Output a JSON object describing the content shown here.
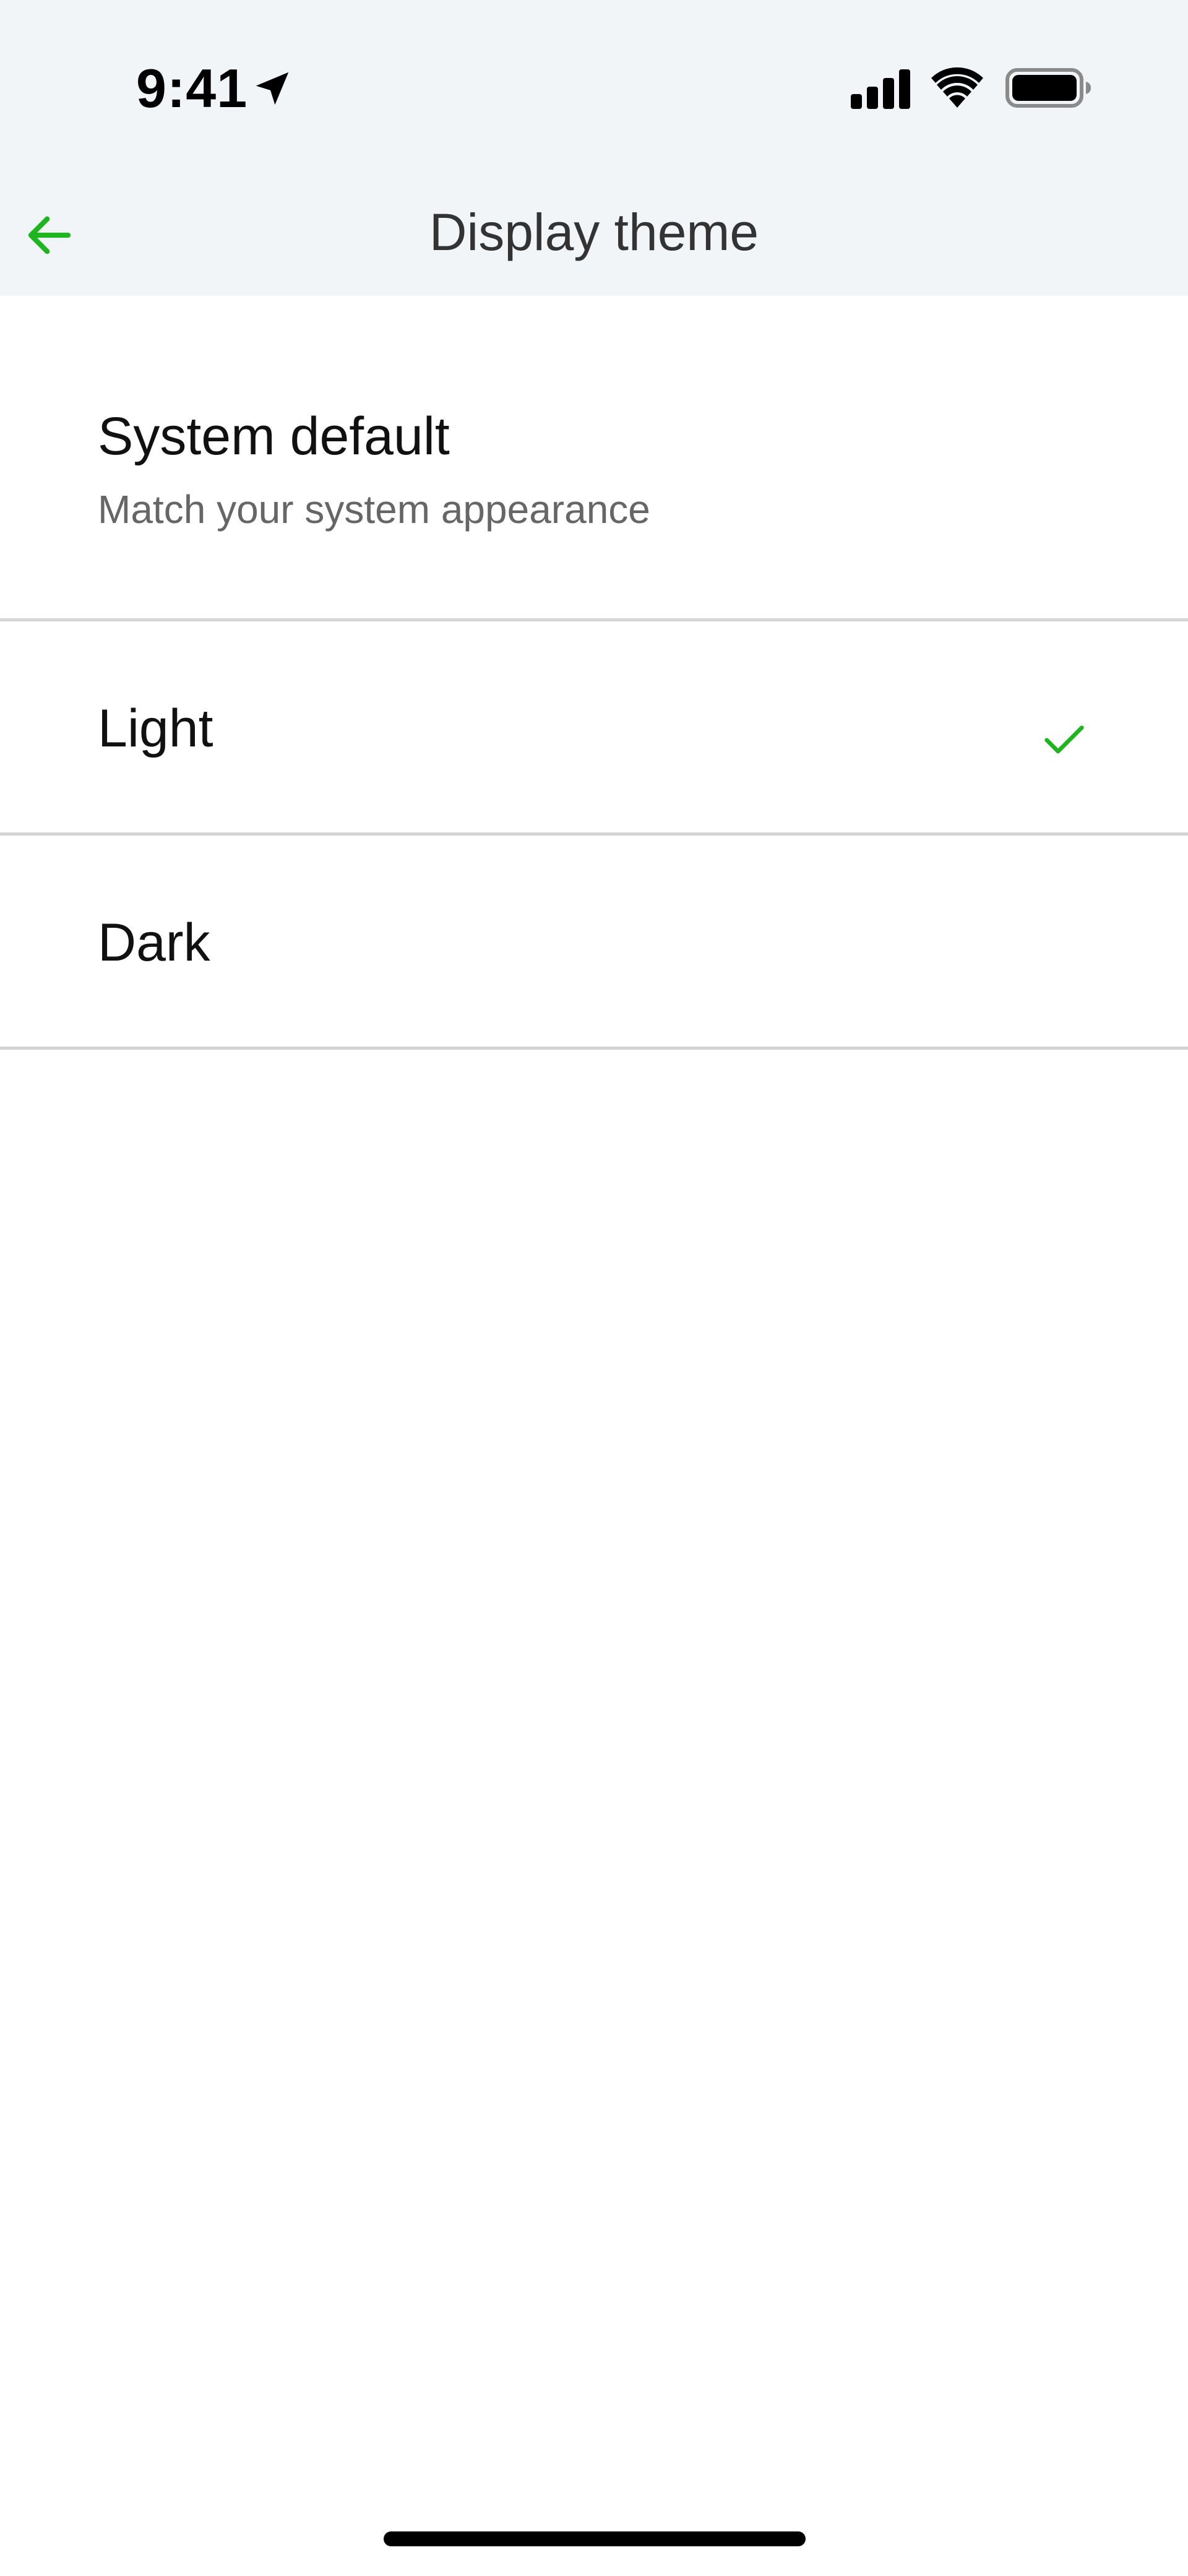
{
  "status_bar": {
    "time": "9:41",
    "icons": [
      "location-arrow-icon",
      "cellular-signal-icon",
      "wifi-icon",
      "battery-icon"
    ]
  },
  "nav": {
    "title": "Display theme",
    "back_icon": "arrow-left-icon"
  },
  "options": [
    {
      "title": "System default",
      "subtitle": "Match your system appearance",
      "selected": false
    },
    {
      "title": "Light",
      "selected": true
    },
    {
      "title": "Dark",
      "selected": false
    }
  ],
  "colors": {
    "accent": "#1fb51f",
    "top_background": "#f2f5f8",
    "divider": "#d4d4d4",
    "subtitle": "#666666"
  }
}
